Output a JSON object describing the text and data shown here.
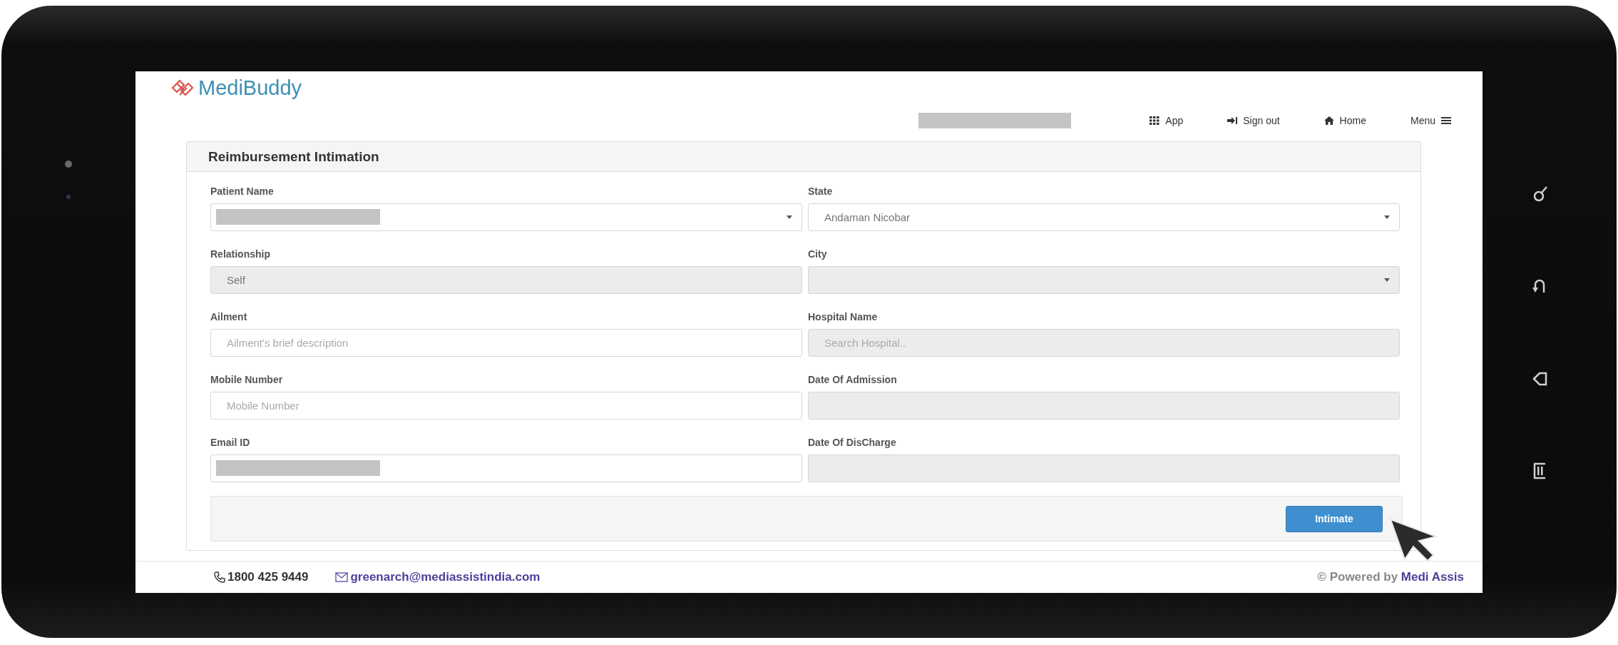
{
  "brand": {
    "logo_text": "MediBuddy"
  },
  "nav": {
    "user_redacted": true,
    "items": [
      {
        "label": "App"
      },
      {
        "label": "Sign out"
      },
      {
        "label": "Home"
      },
      {
        "label": "Menu"
      }
    ]
  },
  "panel": {
    "title": "Reimbursement Intimation",
    "fields": [
      {
        "label": "Patient Name",
        "kind": "select",
        "redacted": true,
        "disabled": false
      },
      {
        "label": "State",
        "kind": "select",
        "value": "Andaman Nicobar",
        "redacted": false,
        "disabled": false
      },
      {
        "label": "Relationship",
        "kind": "input",
        "value": "Self",
        "redacted": false,
        "disabled": true
      },
      {
        "label": "City",
        "kind": "select",
        "redacted": false,
        "disabled": true
      },
      {
        "label": "Ailment",
        "kind": "input",
        "placeholder": "Ailment's brief description",
        "redacted": false,
        "disabled": false
      },
      {
        "label": "Hospital Name",
        "kind": "input",
        "placeholder": "Search Hospital..",
        "redacted": false,
        "disabled": true
      },
      {
        "label": "Mobile Number",
        "kind": "input",
        "placeholder": "Mobile Number",
        "redacted": false,
        "disabled": false
      },
      {
        "label": "Date Of Admission",
        "kind": "input",
        "redacted": false,
        "disabled": true
      },
      {
        "label": "Email ID",
        "kind": "input",
        "redacted": true,
        "disabled": false
      },
      {
        "label": "Date Of DisCharge",
        "kind": "input",
        "redacted": false,
        "disabled": true
      }
    ],
    "submit": "Intimate"
  },
  "footer": {
    "phone": "1800 425 9449",
    "email": "greenarch@mediassistindia.com",
    "powered_by": "© Powered by",
    "company": "Medi Assis"
  }
}
